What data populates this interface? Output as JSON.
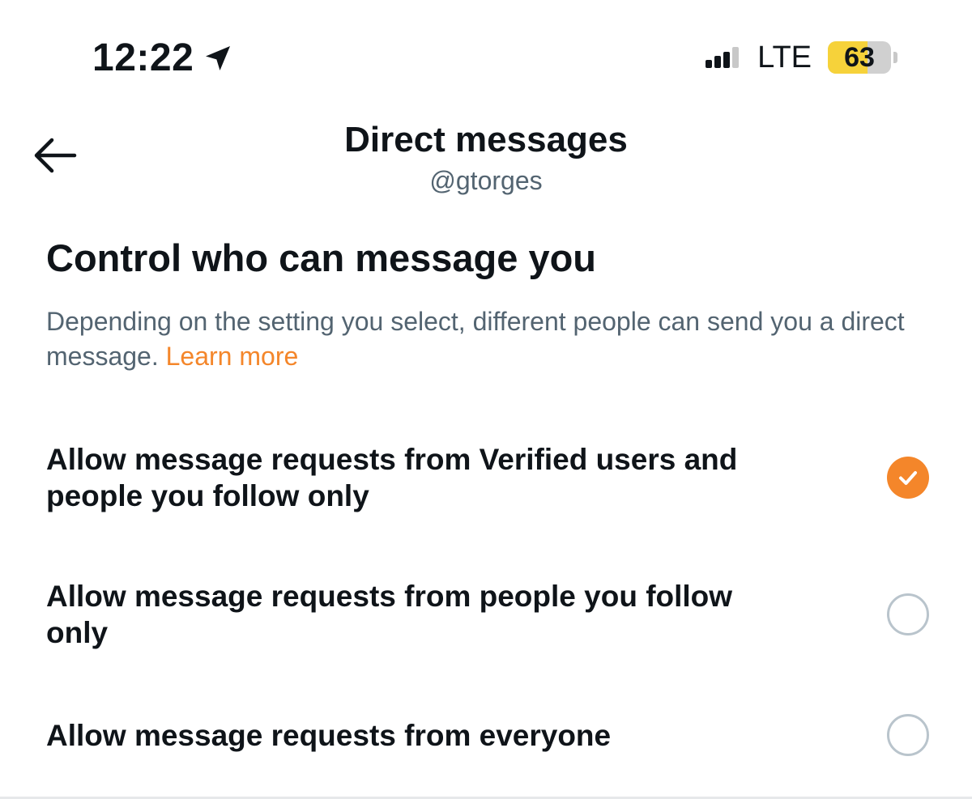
{
  "status_bar": {
    "time": "12:22",
    "location_icon": "location-arrow-icon",
    "signal_icon": "cellular-signal-icon",
    "signal_bars_active": 3,
    "signal_bars_total": 4,
    "network": "LTE",
    "battery_percent": "63",
    "battery_level": 0.63,
    "battery_color": "#f6d23a"
  },
  "header": {
    "back_icon": "arrow-left-icon",
    "title": "Direct messages",
    "subtitle": "@gtorges"
  },
  "section": {
    "heading": "Control who can message you",
    "description": "Depending on the setting you select, different people can send you a direct message.",
    "learn_more": "Learn more"
  },
  "options": [
    {
      "label": "Allow message requests from Verified users and people you follow only",
      "selected": true
    },
    {
      "label": "Allow message requests from people you follow only",
      "selected": false
    },
    {
      "label": "Allow message requests from everyone",
      "selected": false
    }
  ],
  "colors": {
    "accent": "#f4862a",
    "text_primary": "#0f1419",
    "text_secondary": "#536471",
    "radio_border": "#b9c4cc"
  }
}
